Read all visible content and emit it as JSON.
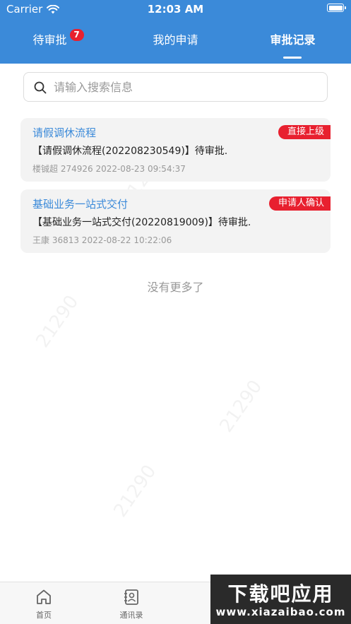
{
  "status_bar": {
    "carrier": "Carrier",
    "time": "12:03 AM"
  },
  "tabs": [
    {
      "label": "待审批",
      "badge": "7"
    },
    {
      "label": "我的申请"
    },
    {
      "label": "审批记录",
      "active": true
    }
  ],
  "search": {
    "placeholder": "请输入搜索信息",
    "value": ""
  },
  "records": [
    {
      "title": "请假调休流程",
      "tag": "直接上级",
      "description": "【请假调休流程(202208230549)】待审批.",
      "meta": "楼铖超 274926 2022-08-23 09:54:37"
    },
    {
      "title": "基础业务一站式交付",
      "tag": "申请人确认",
      "description": "【基础业务一站式交付(20220819009)】待审批.",
      "meta": "王康 36813 2022-08-22 10:22:06"
    }
  ],
  "list_footer": "没有更多了",
  "bottom_nav": [
    {
      "label": "首页",
      "icon": "home-icon"
    },
    {
      "label": "通讯录",
      "icon": "contacts-icon"
    }
  ],
  "watermark": {
    "brand": "下载吧应用",
    "url": "www.xiazaibao.com",
    "number": "21290"
  },
  "colors": {
    "primary": "#3b8ad9",
    "tag_red": "#e8202f",
    "badge_red": "#e8202f"
  }
}
